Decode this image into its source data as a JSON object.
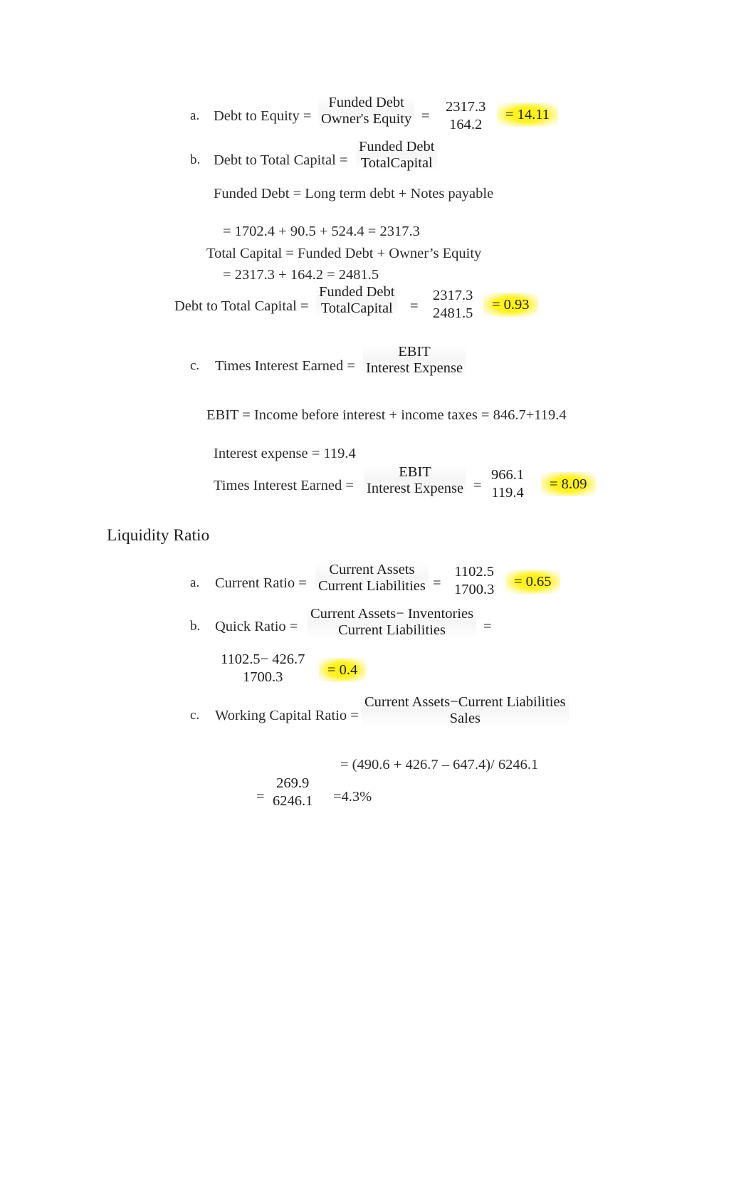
{
  "document": {
    "type": "financial-ratio-worksheet",
    "sections": [
      {
        "id": "leverage",
        "heading": null,
        "items": [
          {
            "letter": "a.",
            "label": "Debt to Equity =",
            "formula": {
              "numerator": "Funded Debt",
              "denominator": "Owner's Equity"
            },
            "equals1": "=",
            "values": {
              "numerator": "2317.3",
              "denominator": "164.2"
            },
            "result": "= 14.11",
            "result_highlighted": true
          },
          {
            "letter": "b.",
            "label": "Debt to Total Capital =",
            "formula": {
              "numerator": "Funded Debt",
              "denominator": "TotalCapital"
            }
          }
        ]
      }
    ],
    "lines": {
      "funded_debt_def": "Funded Debt = Long term debt + Notes payable",
      "funded_debt_calc": "= 1702.4 + 90.5 + 524.4 = 2317.3",
      "total_capital_def": "Total Capital = Funded Debt + Owner’s Equity",
      "total_capital_calc": "= 2317.3 + 164.2 = 2481.5",
      "ebit_def": "EBIT = Income before interest + income taxes = 846.7+119.4",
      "interest_expense_def": "Interest expense = 119.4",
      "working_capital_calc": "= (490.6 + 426.7 – 647.4)/ 6246.1",
      "working_capital_percent": "=4.3%"
    },
    "debt_to_total_capital_solved": {
      "label": "Debt to Total Capital =",
      "formula": {
        "numerator": "Funded Debt",
        "denominator": "TotalCapital"
      },
      "equals1": "=",
      "values": {
        "numerator": "2317.3",
        "denominator": "2481.5"
      },
      "result": "= 0.93",
      "result_highlighted": true
    },
    "times_interest_earned": {
      "letter": "c.",
      "label": "Times Interest Earned =",
      "formula": {
        "numerator": "EBIT",
        "denominator": "Interest Expense"
      }
    },
    "times_interest_earned_solved": {
      "label": "Times Interest Earned =",
      "formula": {
        "numerator": "EBIT",
        "denominator": "Interest Expense"
      },
      "equals1": "=",
      "values": {
        "numerator": "966.1",
        "denominator": "119.4"
      },
      "result": "= 8.09",
      "result_highlighted": true
    },
    "liquidity": {
      "heading": "Liquidity Ratio",
      "current_ratio": {
        "letter": "a.",
        "label": "Current Ratio =",
        "formula": {
          "numerator": "Current Assets",
          "denominator": "Current Liabilities"
        },
        "equals1": "=",
        "values": {
          "numerator": "1102.5",
          "denominator": "1700.3"
        },
        "result": "= 0.65",
        "result_highlighted": true
      },
      "quick_ratio": {
        "letter": "b.",
        "label": "Quick Ratio =",
        "formula": {
          "numerator": "Current Assets− Inventories",
          "denominator": "Current Liabilities"
        },
        "equals1": "=",
        "values": {
          "numerator": "1102.5− 426.7",
          "denominator": "1700.3"
        },
        "result": "= 0.4",
        "result_highlighted": true
      },
      "working_capital_ratio": {
        "letter": "c.",
        "label": "Working Capital Ratio =",
        "formula": {
          "numerator": "Current Assets−Current Liabilities",
          "denominator": "Sales"
        },
        "equals1": "=",
        "values": {
          "numerator": "269.9",
          "denominator": "6246.1"
        }
      }
    },
    "colors": {
      "text": "#2b2b2b",
      "highlight": "#fff000"
    }
  }
}
